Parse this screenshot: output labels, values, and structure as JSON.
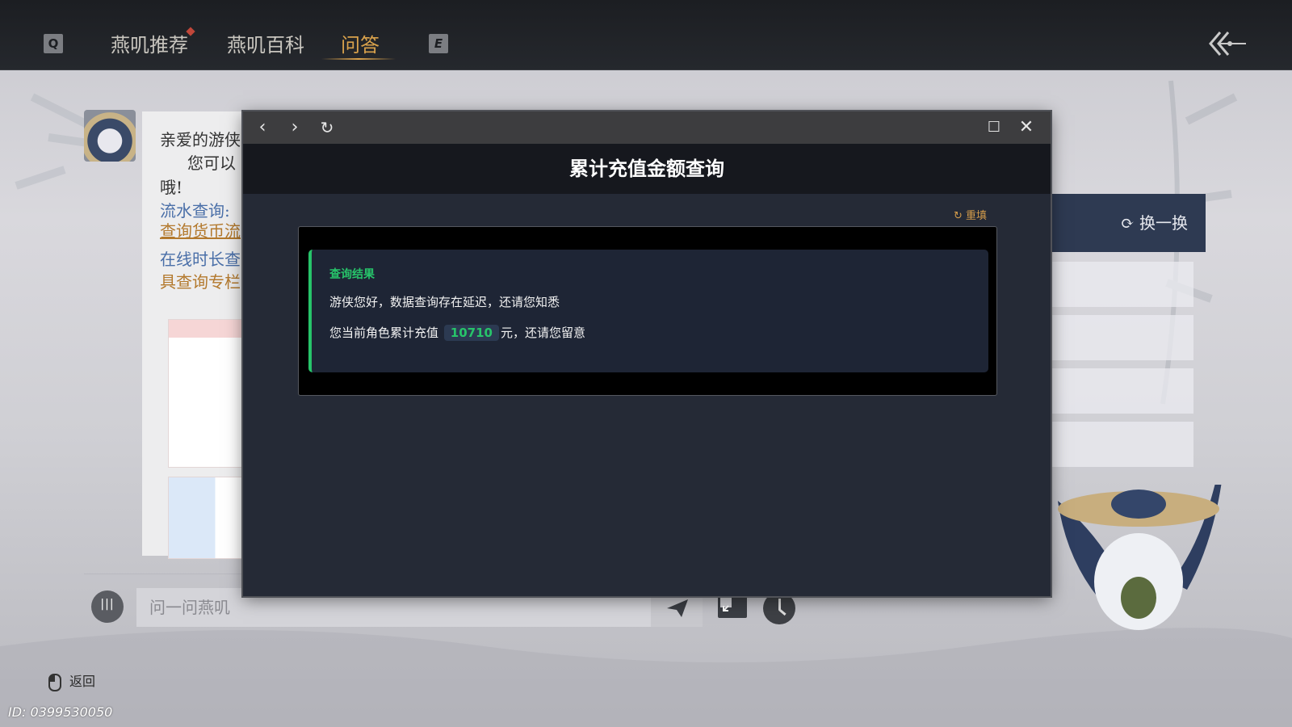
{
  "topnav": {
    "key_left": "Q",
    "key_right": "E",
    "tabs": [
      {
        "label": "燕叽推荐"
      },
      {
        "label": "燕叽百科"
      },
      {
        "label": "问答"
      }
    ],
    "active_tab": "问答"
  },
  "chat": {
    "line1": "亲爱的游侠",
    "line2": "您可以",
    "line3": "哦!",
    "link1": "流水查询:",
    "link1_sub": "查询货币流",
    "link2": "在线时长查",
    "link2_sub": "具查询专栏"
  },
  "input": {
    "placeholder": "问一问燕叽"
  },
  "side_panel": {
    "refresh_label": "换一换"
  },
  "footer": {
    "back_label": "返回",
    "uid": "ID: 0399530050"
  },
  "modal": {
    "page_title": "累计充值金额查询",
    "reset_label": "重填",
    "result_title": "查询结果",
    "result_line1": "游侠您好，数据查询存在延迟，还请您知悉",
    "result_line2_prefix": "您当前角色累计充值",
    "amount": "10710",
    "result_line2_suffix": "元，还请您留意"
  },
  "colors": {
    "accent_gold": "#d9a24c",
    "success_green": "#27c46a",
    "modal_bg": "#252a36"
  }
}
